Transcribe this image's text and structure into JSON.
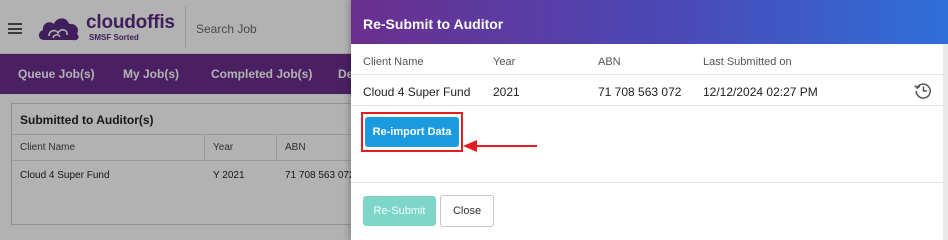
{
  "app": {
    "logo_name": "cloudoffis",
    "logo_tagline": "SMSF Sorted",
    "search_placeholder": "Search Job",
    "brand_color": "#6a2f8e"
  },
  "nav": {
    "items": [
      {
        "label": "Queue Job(s)"
      },
      {
        "label": "My Job(s)"
      },
      {
        "label": "Completed Job(s)"
      },
      {
        "label": "De"
      }
    ]
  },
  "background_panel": {
    "title": "Submitted to Auditor(s)",
    "columns": [
      "Client Name",
      "Year",
      "ABN"
    ],
    "rows": [
      {
        "client": "Cloud 4 Super Fund",
        "year": "Y 2021",
        "abn": "71 708 563 072"
      }
    ]
  },
  "modal": {
    "title": "Re-Submit to Auditor",
    "columns": [
      "Client Name",
      "Year",
      "ABN",
      "Last Submitted on"
    ],
    "row": {
      "client": "Cloud 4 Super Fund",
      "year": "2021",
      "abn": "71 708 563 072",
      "last_submitted": "12/12/2024 02:27 PM",
      "action_icon": "history-icon"
    },
    "reimport_label": "Re-import Data",
    "resubmit_label": "Re-Submit",
    "close_label": "Close",
    "colors": {
      "reimport": "#1a9be0",
      "resubmit_disabled": "#7dd6c8",
      "highlight": "#e31b23"
    }
  }
}
